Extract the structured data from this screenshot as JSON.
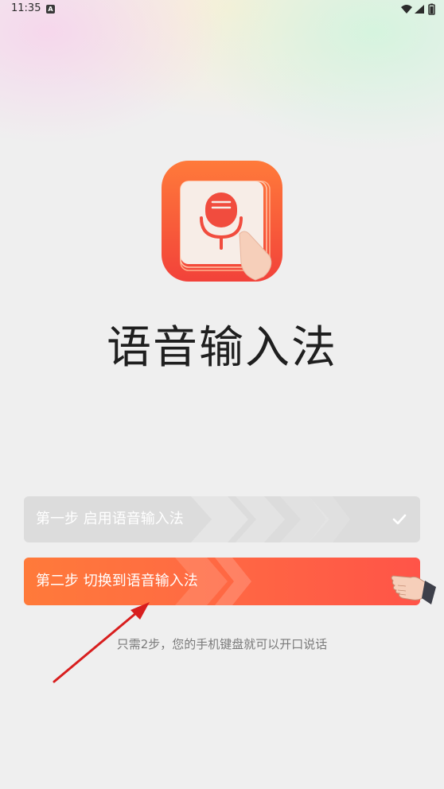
{
  "status_bar": {
    "time": "11:35",
    "notification_letter": "A",
    "icons": [
      "wifi-icon",
      "signal-icon",
      "battery-icon"
    ]
  },
  "app": {
    "icon": "microphone-icon",
    "title": "语音输入法"
  },
  "steps": [
    {
      "label": "第一步 启用语音输入法",
      "completed": true,
      "icon": "check-icon"
    },
    {
      "label": "第二步 切换到语音输入法",
      "completed": false,
      "icon": "pointing-hand-icon"
    }
  ],
  "hint": "只需2步，您的手机键盘就可以开口说话",
  "colors": {
    "accent": "#ff6640",
    "completed_bg": "#dcdcdc",
    "title": "#1f1f1f",
    "hint": "#7a7a7a",
    "annotation": "#d81e1e"
  }
}
